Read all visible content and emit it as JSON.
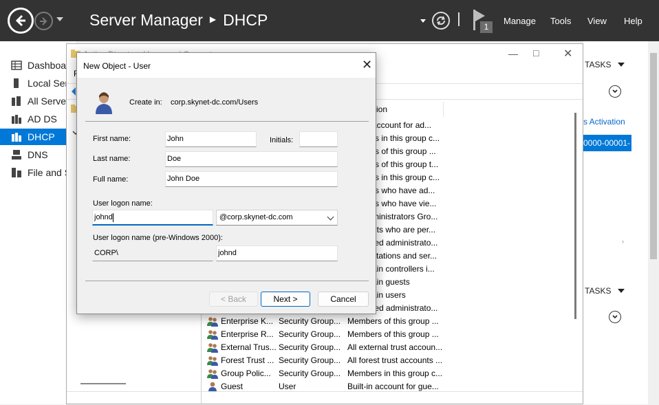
{
  "server_manager": {
    "title_app": "Server Manager",
    "title_page": "DHCP",
    "menu": [
      "Manage",
      "Tools",
      "View",
      "Help"
    ],
    "notification_count": "1",
    "nav": [
      {
        "label": "Dashboard"
      },
      {
        "label": "Local Server"
      },
      {
        "label": "All Servers"
      },
      {
        "label": "AD DS"
      },
      {
        "label": "DHCP",
        "selected": true
      },
      {
        "label": "DNS"
      },
      {
        "label": "File and S"
      }
    ],
    "tasks_label": "TASKS",
    "right_link": "s Activation",
    "right_selected": "0000-00001-"
  },
  "aduc": {
    "title": "Active Directory Users and Computers",
    "menu_first": "F",
    "col_header": "ition",
    "desc_fragments": [
      "account for ad...",
      "rs in this group c...",
      "rs of this group ...",
      "rs of this group t...",
      "rs in this group c...",
      "rs who have ad...",
      "rs who have vie...",
      "ministrators Gro...",
      "nts who are per...",
      "ted administrato...",
      "stations and ser...",
      "ain controllers i...",
      "ain guests",
      "ain users",
      "ted administrato..."
    ],
    "rows": [
      {
        "name": "Enterprise K...",
        "type": "Security Group...",
        "desc": "Members of this group ..."
      },
      {
        "name": "Enterprise R...",
        "type": "Security Group...",
        "desc": "Members of this group ..."
      },
      {
        "name": "External Trus...",
        "type": "Security Group...",
        "desc": "All external trust accoun..."
      },
      {
        "name": "Forest Trust ...",
        "type": "Security Group...",
        "desc": "All forest trust accounts ..."
      },
      {
        "name": "Group Polic...",
        "type": "Security Group...",
        "desc": "Members in this group c..."
      },
      {
        "name": "Guest",
        "type": "User",
        "desc": "Built-in account for gue..."
      }
    ]
  },
  "dialog": {
    "title": "New Object - User",
    "create_in_label": "Create in:",
    "create_in_value": "corp.skynet-dc.com/Users",
    "first_name_label": "First name:",
    "first_name": "John",
    "initials_label": "Initials:",
    "initials": "",
    "last_name_label": "Last name:",
    "last_name": "Doe",
    "full_name_label": "Full name:",
    "full_name": "John Doe",
    "logon_label": "User logon name:",
    "logon_name": "johnd",
    "domain_suffix": "@corp.skynet-dc.com",
    "pre2000_label": "User logon name (pre-Windows 2000):",
    "pre2000_domain": "CORP\\",
    "pre2000_name": "johnd",
    "back_label": "< Back",
    "next_label": "Next >",
    "cancel_label": "Cancel"
  }
}
